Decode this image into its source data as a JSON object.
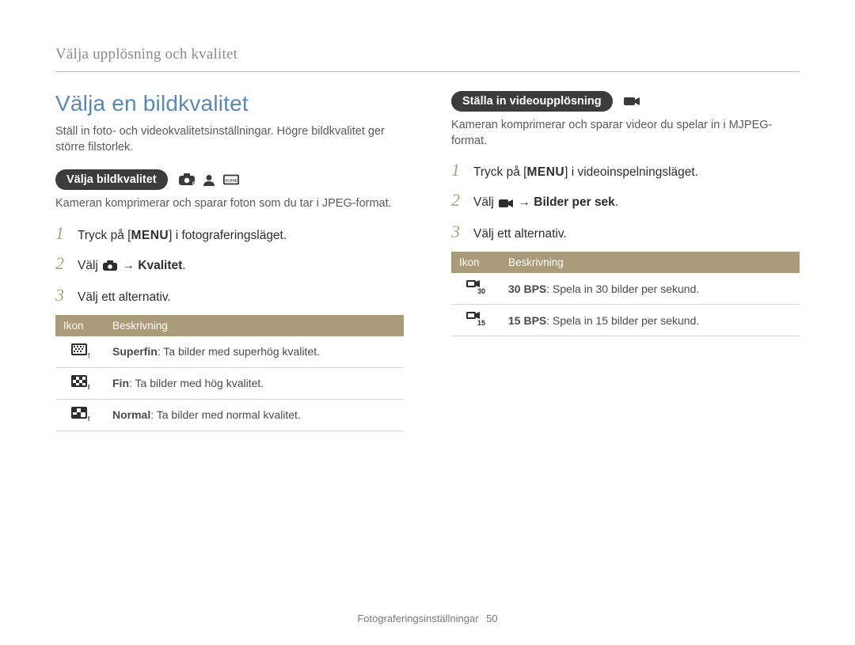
{
  "breadcrumb": "Välja upplösning och kvalitet",
  "heading": "Välja en bildkvalitet",
  "intro": "Ställ in foto- och videokvalitetsinställningar. Högre bildkvalitet ger större filstorlek.",
  "left": {
    "pill": "Välja bildkvalitet",
    "sub": "Kameran komprimerar och sparar foton som du tar i JPEG-format.",
    "steps": {
      "s1_a": "Tryck på [",
      "menu": "MENU",
      "s1_b": "] i fotograferingsläget.",
      "s2_a": "Välj ",
      "s2_arrow": " → ",
      "s2_bold": "Kvalitet",
      "s2_end": ".",
      "s3": "Välj ett alternativ."
    },
    "table": {
      "h_icon": "Ikon",
      "h_desc": "Beskrivning",
      "rows": [
        {
          "name": "Superfin",
          "desc": ": Ta bilder med superhög kvalitet."
        },
        {
          "name": "Fin",
          "desc": ": Ta bilder med hög kvalitet."
        },
        {
          "name": "Normal",
          "desc": ": Ta bilder med normal kvalitet."
        }
      ]
    }
  },
  "right": {
    "pill": "Ställa in videoupplösning",
    "sub": "Kameran komprimerar och sparar videor du spelar in i MJPEG-format.",
    "steps": {
      "s1_a": "Tryck på [",
      "menu": "MENU",
      "s1_b": "] i videoinspelningsläget.",
      "s2_a": "Välj ",
      "s2_arrow": " → ",
      "s2_bold": "Bilder per sek",
      "s2_end": ".",
      "s3": "Välj ett alternativ."
    },
    "table": {
      "h_icon": "Ikon",
      "h_desc": "Beskrivning",
      "rows": [
        {
          "name": "30 BPS",
          "desc": ": Spela in 30 bilder per sekund."
        },
        {
          "name": "15 BPS",
          "desc": ": Spela in 15 bilder per sekund."
        }
      ]
    }
  },
  "footer": {
    "section": "Fotograferingsinställningar",
    "page": "50"
  }
}
